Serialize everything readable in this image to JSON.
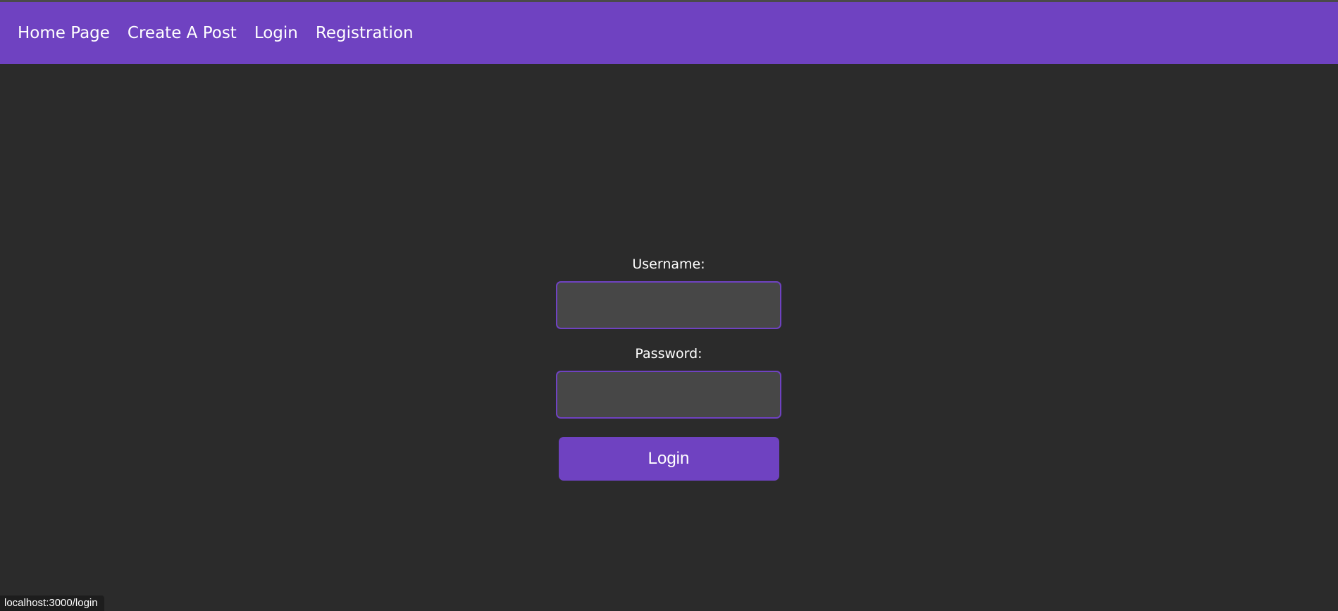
{
  "nav": {
    "items": [
      {
        "label": "Home Page"
      },
      {
        "label": "Create A Post"
      },
      {
        "label": "Login"
      },
      {
        "label": "Registration"
      }
    ]
  },
  "form": {
    "username_label": "Username:",
    "username_value": "",
    "password_label": "Password:",
    "password_value": "",
    "submit_label": "Login"
  },
  "status_bar": {
    "url": "localhost:3000/login"
  },
  "colors": {
    "accent": "#6f42c1",
    "background": "#2b2b2b",
    "input_background": "#474747"
  }
}
